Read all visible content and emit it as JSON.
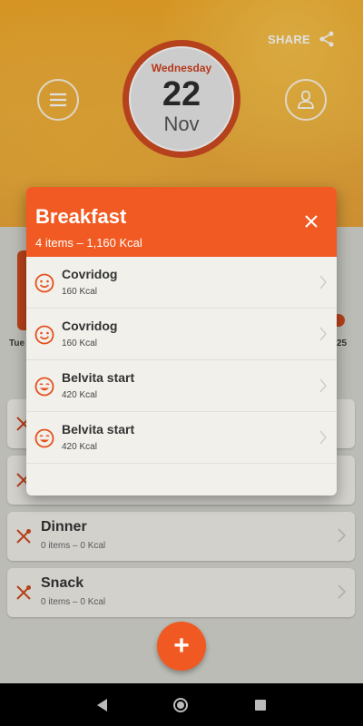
{
  "header": {
    "share_label": "SHARE",
    "date": {
      "weekday": "Wednesday",
      "day": "22",
      "month": "Nov"
    }
  },
  "week": {
    "left_label": "Tue",
    "right_label": "25"
  },
  "meals": [
    {
      "title": "Dinner",
      "subtitle": "0 items – 0 Kcal"
    },
    {
      "title": "Snack",
      "subtitle": "0 items – 0 Kcal"
    }
  ],
  "dialog": {
    "title": "Breakfast",
    "subtitle": "4 items – 1,160 Kcal",
    "items": [
      {
        "name": "Covridog",
        "kcal": "160 Kcal",
        "icon": "smile-icon"
      },
      {
        "name": "Covridog",
        "kcal": "160 Kcal",
        "icon": "smile-icon"
      },
      {
        "name": "Belvita start",
        "kcal": "420 Kcal",
        "icon": "grin-icon"
      },
      {
        "name": "Belvita start",
        "kcal": "420 Kcal",
        "icon": "grin-icon"
      }
    ]
  },
  "fab": {
    "label": "+"
  },
  "colors": {
    "accent": "#f15a22",
    "header": "#f3a928",
    "date_ring": "#cf4a22"
  }
}
